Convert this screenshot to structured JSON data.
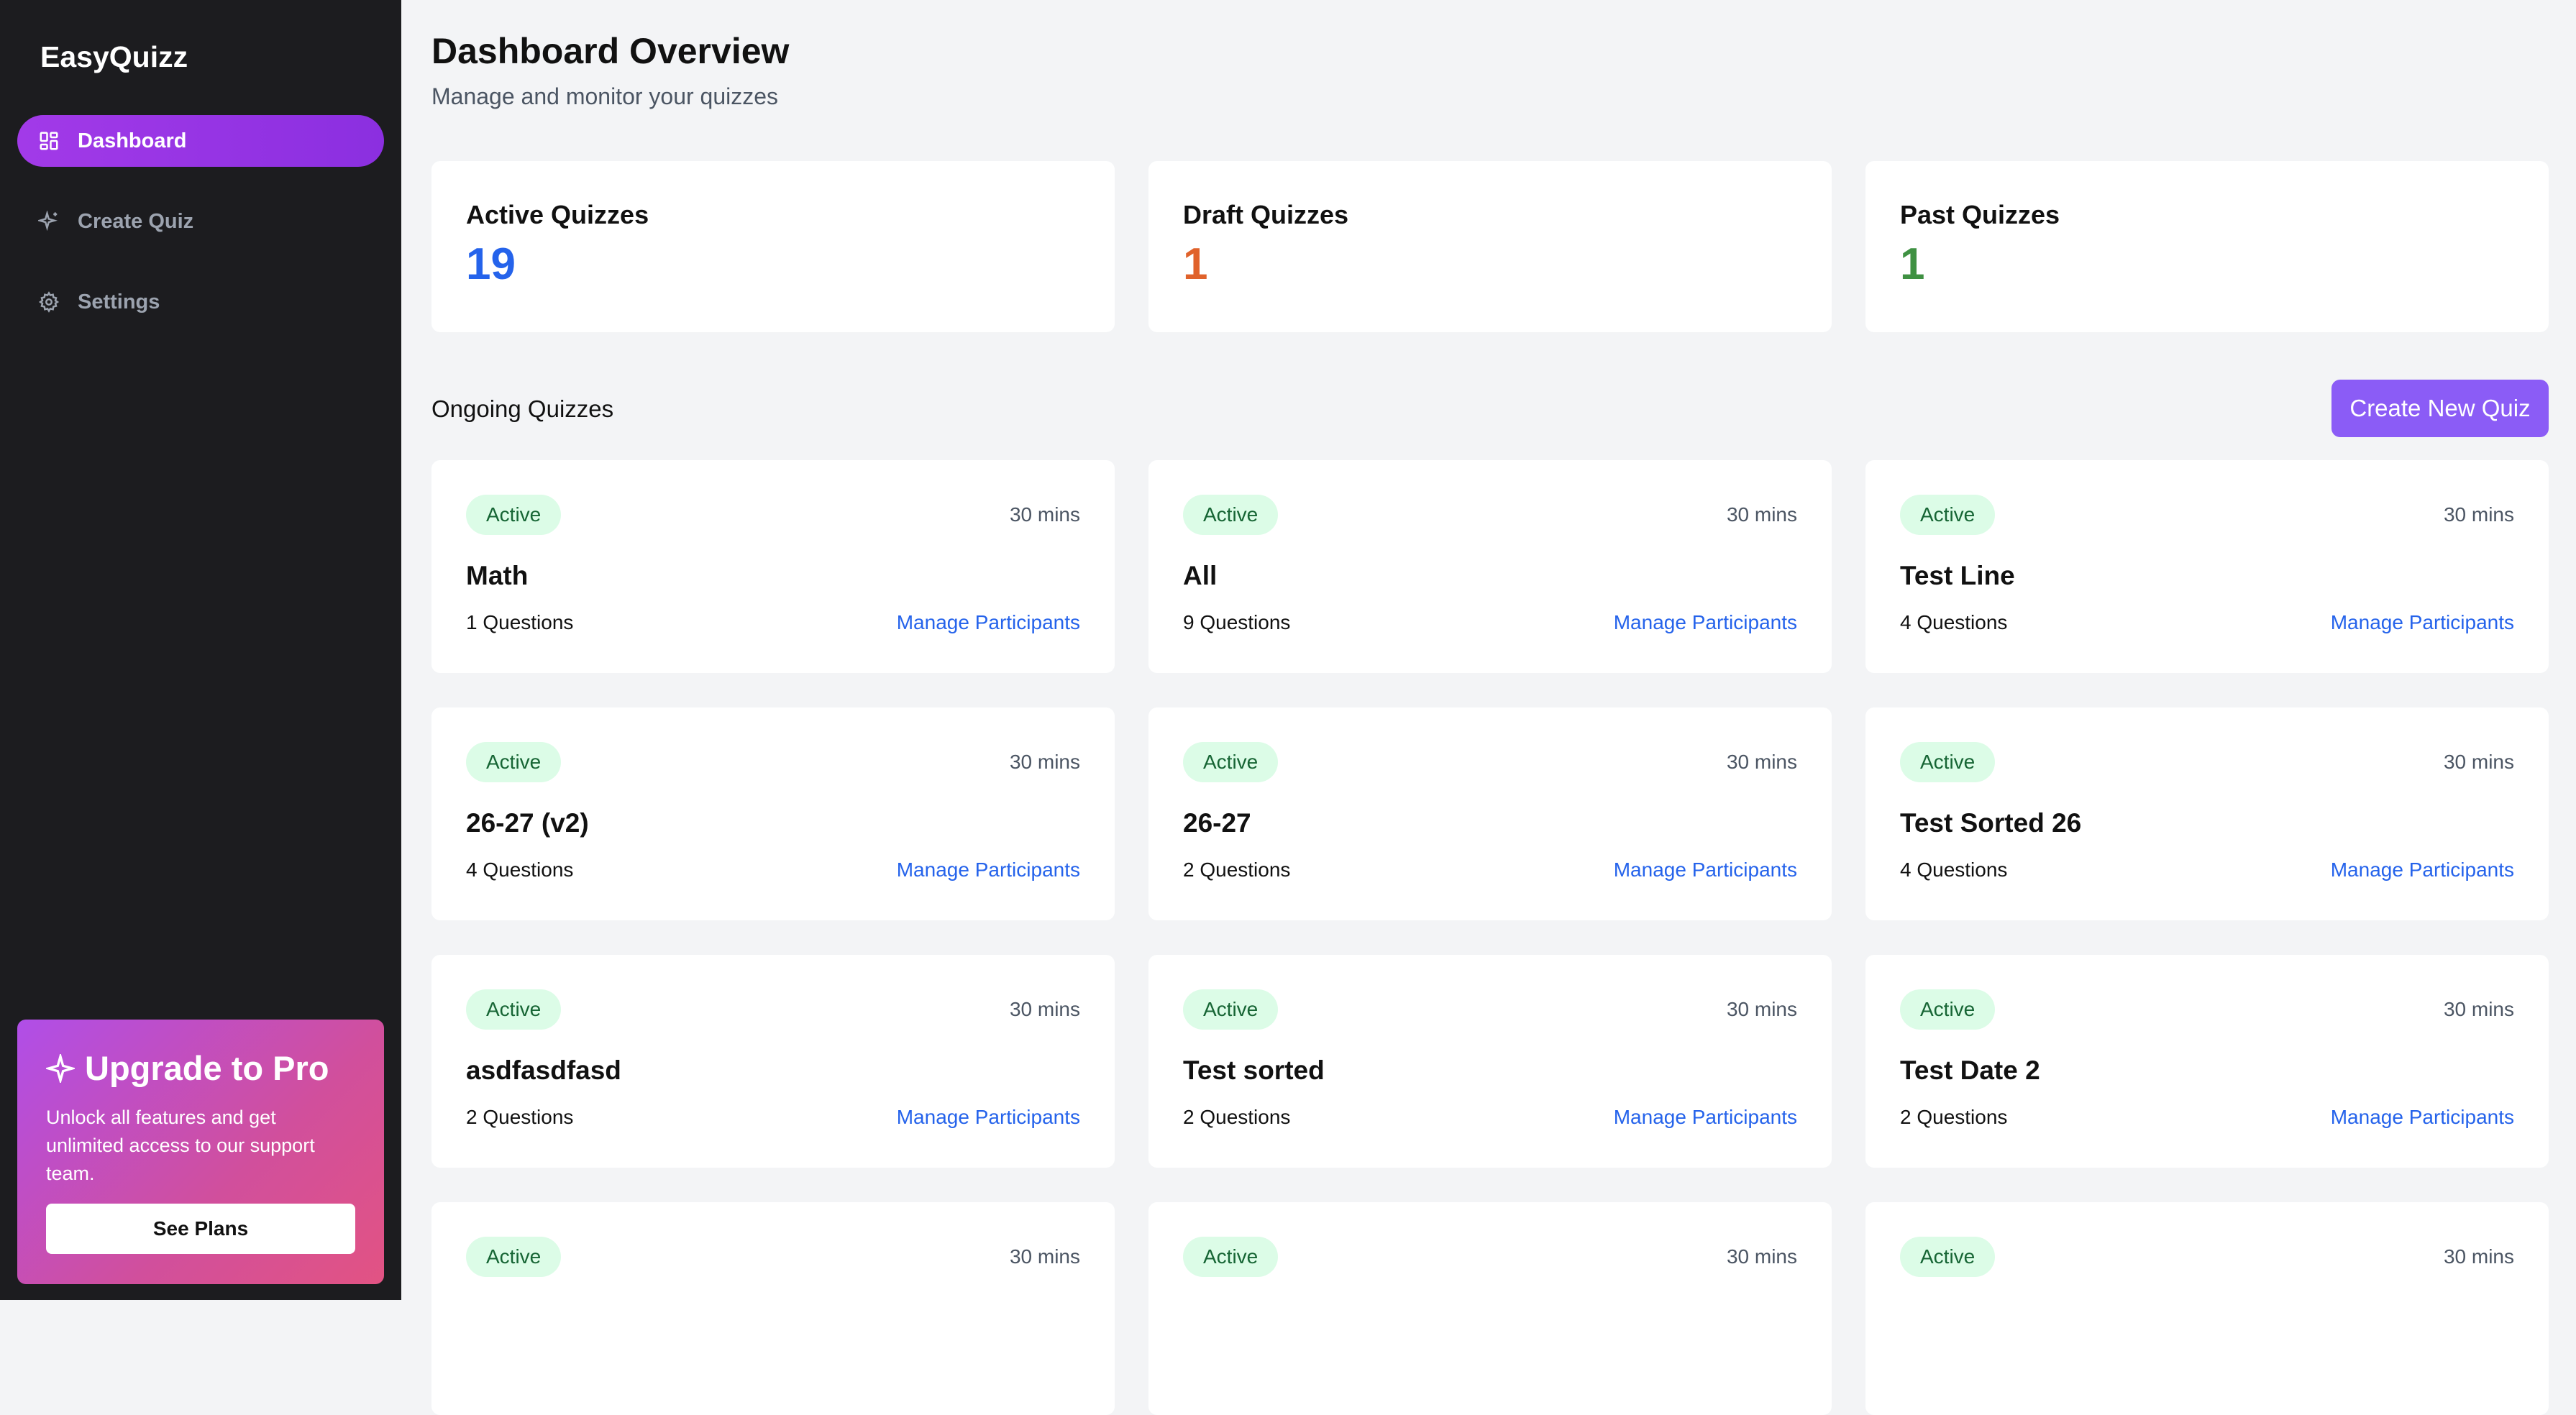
{
  "app": {
    "brand": "EasyQuizz"
  },
  "sidebar": {
    "items": [
      {
        "label": "Dashboard",
        "icon": "grid-icon"
      },
      {
        "label": "Create Quiz",
        "icon": "sparkle-icon"
      },
      {
        "label": "Settings",
        "icon": "gear-icon"
      }
    ]
  },
  "upgrade": {
    "title": "Upgrade to Pro",
    "text": "Unlock all features and get unlimited access to our support team.",
    "button": "See Plans"
  },
  "header": {
    "title": "Dashboard Overview",
    "subtitle": "Manage and monitor your quizzes"
  },
  "stats": [
    {
      "label": "Active Quizzes",
      "value": "19",
      "color": "#2563eb"
    },
    {
      "label": "Draft Quizzes",
      "value": "1",
      "color": "#e0622b"
    },
    {
      "label": "Past Quizzes",
      "value": "1",
      "color": "#3f9142"
    }
  ],
  "ongoing": {
    "title": "Ongoing Quizzes",
    "create_button": "Create New Quiz",
    "quizzes": [
      {
        "status": "Active",
        "duration": "30 mins",
        "title": "Math",
        "questions": "1 Questions",
        "link": "Manage Participants"
      },
      {
        "status": "Active",
        "duration": "30 mins",
        "title": "All",
        "questions": "9 Questions",
        "link": "Manage Participants"
      },
      {
        "status": "Active",
        "duration": "30 mins",
        "title": "Test Line",
        "questions": "4 Questions",
        "link": "Manage Participants"
      },
      {
        "status": "Active",
        "duration": "30 mins",
        "title": "26-27 (v2)",
        "questions": "4 Questions",
        "link": "Manage Participants"
      },
      {
        "status": "Active",
        "duration": "30 mins",
        "title": "26-27",
        "questions": "2 Questions",
        "link": "Manage Participants"
      },
      {
        "status": "Active",
        "duration": "30 mins",
        "title": "Test Sorted 26",
        "questions": "4 Questions",
        "link": "Manage Participants"
      },
      {
        "status": "Active",
        "duration": "30 mins",
        "title": "asdfasdfasd",
        "questions": "2 Questions",
        "link": "Manage Participants"
      },
      {
        "status": "Active",
        "duration": "30 mins",
        "title": "Test sorted",
        "questions": "2 Questions",
        "link": "Manage Participants"
      },
      {
        "status": "Active",
        "duration": "30 mins",
        "title": "Test Date 2",
        "questions": "2 Questions",
        "link": "Manage Participants"
      },
      {
        "status": "Active",
        "duration": "30 mins"
      },
      {
        "status": "Active",
        "duration": "30 mins"
      },
      {
        "status": "Active",
        "duration": "30 mins"
      }
    ]
  }
}
